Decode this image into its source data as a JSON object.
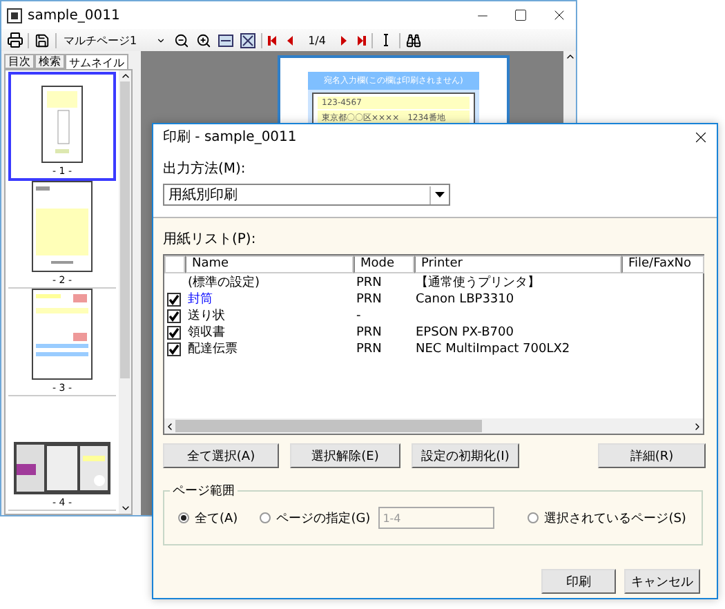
{
  "main_window": {
    "title": "sample_0011",
    "toolbar": {
      "page_select": "マルチページ1",
      "page_counter": "1/4"
    },
    "side_tabs": [
      {
        "label": "目次",
        "selected": false
      },
      {
        "label": "検索",
        "selected": false
      },
      {
        "label": "サムネイル",
        "selected": true
      }
    ],
    "thumbnails": [
      {
        "label": "- 1 -",
        "selected": true
      },
      {
        "label": "- 2 -",
        "selected": false
      },
      {
        "label": "- 3 -",
        "selected": false
      },
      {
        "label": "- 4 -",
        "selected": false
      }
    ],
    "preview": {
      "banner": "宛名入力欄(この欄は印刷されません)",
      "postal_code": "123-4567",
      "address": "東京都〇〇区××××　1234番地"
    }
  },
  "dialog": {
    "title": "印刷 - sample_0011",
    "output_label": "出力方法(M):",
    "output_value": "用紙別印刷",
    "list_label": "用紙リスト(P):",
    "columns": [
      "Name",
      "Mode",
      "Printer",
      "File/FaxNo"
    ],
    "rows": [
      {
        "checked": false,
        "selected": false,
        "name": "(標準の設定)",
        "mode": "PRN",
        "printer": "【通常使うプリンタ】"
      },
      {
        "checked": true,
        "selected": true,
        "name": "封筒",
        "mode": "PRN",
        "printer": "Canon LBP3310"
      },
      {
        "checked": true,
        "selected": false,
        "name": "送り状",
        "mode": "-",
        "printer": ""
      },
      {
        "checked": true,
        "selected": false,
        "name": "領収書",
        "mode": "PRN",
        "printer": "EPSON PX-B700"
      },
      {
        "checked": true,
        "selected": false,
        "name": "配達伝票",
        "mode": "PRN",
        "printer": "NEC MultiImpact 700LX2"
      }
    ],
    "list_buttons": [
      "全て選択(A)",
      "選択解除(E)",
      "設定の初期化(I)"
    ],
    "detail_button": "詳細(R)",
    "page_range": {
      "legend": "ページ範囲",
      "options": [
        {
          "label": "全て(A)",
          "selected": true
        },
        {
          "label": "ページの指定(G)",
          "selected": false
        },
        {
          "label": "選択されているページ(S)",
          "selected": false
        }
      ],
      "range_value": "1-4"
    },
    "buttons": [
      "印刷",
      "キャンセル"
    ]
  }
}
